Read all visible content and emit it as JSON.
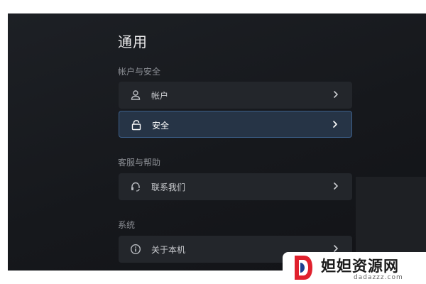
{
  "page": {
    "title": "通用"
  },
  "sections": [
    {
      "header": "帐户与安全",
      "items": [
        {
          "label": "帐户",
          "icon": "user-icon",
          "selected": false
        },
        {
          "label": "安全",
          "icon": "lock-icon",
          "selected": true
        }
      ]
    },
    {
      "header": "客服与帮助",
      "items": [
        {
          "label": "联系我们",
          "icon": "headset-icon",
          "selected": false
        }
      ]
    },
    {
      "header": "系统",
      "items": [
        {
          "label": "关于本机",
          "icon": "info-icon",
          "selected": false
        }
      ]
    }
  ],
  "watermark": {
    "name": "妲妲资源网",
    "domain": "dadazzz.com"
  },
  "colors": {
    "accent_border": "#3c5f8a",
    "selected_bg": "#263446",
    "logo_red": "#e0212d"
  }
}
